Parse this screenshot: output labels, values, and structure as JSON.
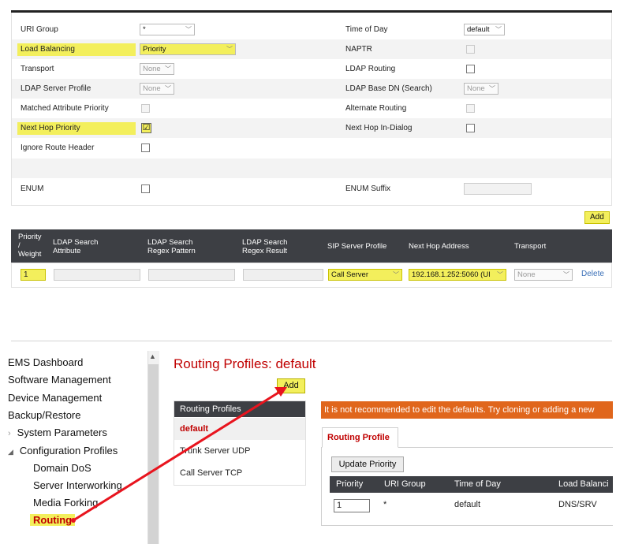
{
  "rule_form": {
    "rows_left": [
      {
        "label": "URI Group",
        "control": "*"
      },
      {
        "label": "Load Balancing",
        "control": "Priority"
      },
      {
        "label": "Transport",
        "control": "None"
      },
      {
        "label": "LDAP Server Profile",
        "control": "None"
      },
      {
        "label": "Matched Attribute Priority"
      },
      {
        "label": "Next Hop Priority",
        "checked": "☑"
      },
      {
        "label": "Ignore Route Header"
      },
      {
        "label": ""
      },
      {
        "label": "ENUM"
      }
    ],
    "rows_right": [
      {
        "label": "Time of Day",
        "control": "default"
      },
      {
        "label": "NAPTR"
      },
      {
        "label": "LDAP Routing"
      },
      {
        "label": "LDAP Base DN (Search)",
        "control": "None"
      },
      {
        "label": "Alternate Routing"
      },
      {
        "label": "Next Hop In-Dialog"
      },
      {
        "label": ""
      },
      {
        "label": ""
      },
      {
        "label": "ENUM Suffix"
      }
    ],
    "add_label": "Add",
    "grid_headers": {
      "priority": "Priority",
      "slash": "/",
      "weight": "Weight",
      "ldap_attr_1": "LDAP Search",
      "ldap_attr_2": "Attribute",
      "ldap_regex_1": "LDAP Search",
      "ldap_regex_2": "Regex Pattern",
      "ldap_result_1": "LDAP Search",
      "ldap_result_2": "Regex Result",
      "sip_profile": "SIP Server Profile",
      "next_hop": "Next Hop Address",
      "transport": "Transport"
    },
    "grid_row": {
      "priority": "1",
      "sip_profile": "Call Server",
      "next_hop": "192.168.1.252:5060 (UI",
      "transport": "None",
      "delete": "Delete"
    }
  },
  "ems": {
    "nav": {
      "dashboard": "EMS Dashboard",
      "software": "Software Management",
      "device": "Device Management",
      "backup": "Backup/Restore",
      "system_params": "System Parameters",
      "config_profiles": "Configuration Profiles",
      "domain_dos": "Domain DoS",
      "server_interworking": "Server Interworking",
      "media_forking": "Media Forking",
      "routing": "Routing"
    },
    "title": "Routing Profiles: default",
    "add_label": "Add",
    "profiles": {
      "header": "Routing Profiles",
      "items": [
        "default",
        "Trunk Server UDP",
        "Call Server TCP"
      ]
    },
    "warning": "It is not recommended to edit the defaults. Try cloning or adding a new",
    "tab": "Routing Profile",
    "update_priority": "Update Priority",
    "table": {
      "headers": [
        "Priority",
        "URI Group",
        "Time of Day",
        "Load Balanci"
      ],
      "row": {
        "priority": "1",
        "uri_group": "*",
        "time_of_day": "default",
        "load_balancing": "DNS/SRV"
      }
    }
  },
  "colors": {
    "highlight": "#f3ef5c",
    "accent_red": "#c00000",
    "warning_orange": "#e0661c",
    "header_dark": "#3d3f44",
    "arrow": "#e8141e"
  }
}
